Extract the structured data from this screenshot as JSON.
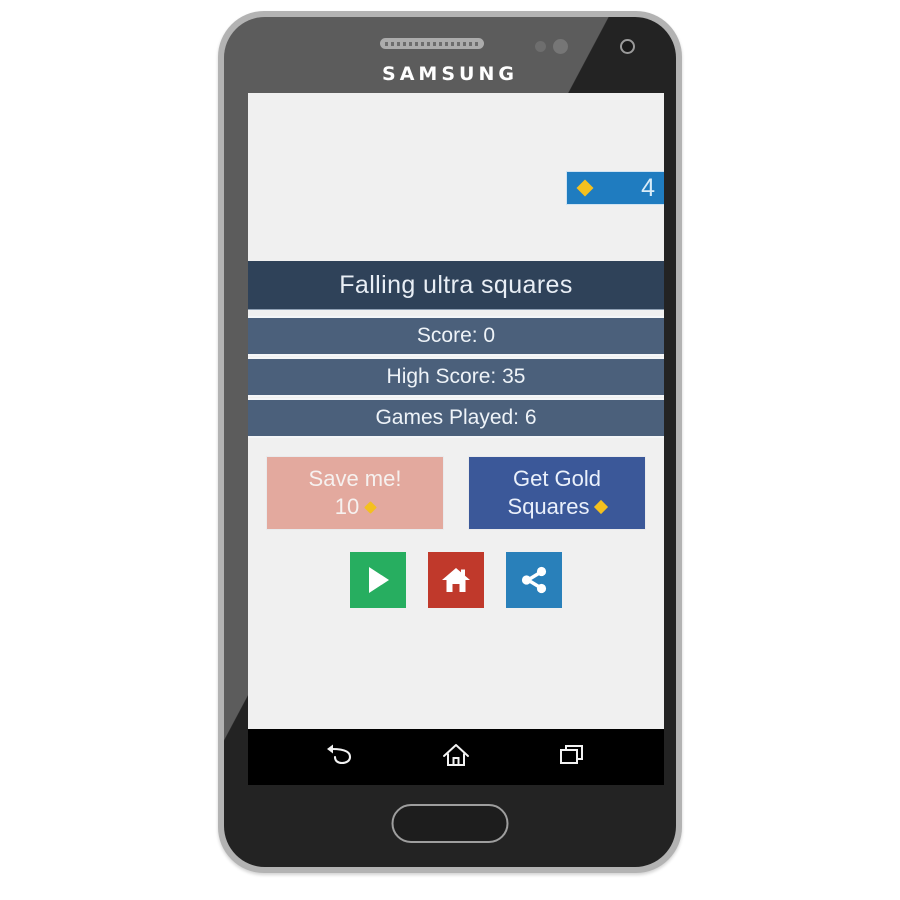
{
  "device": {
    "brand_label": "SAMSUNG",
    "frame_color": "#b3b3b3",
    "body_color": "#232323"
  },
  "app": {
    "title": "Falling ultra squares",
    "title_bar_color": "#2f4259",
    "screen_background": "#f0f0f0"
  },
  "gold_badge": {
    "count": "4",
    "icon": "gold-diamond-icon",
    "background": "#1f7cc0",
    "diamond_color": "#f4c01e"
  },
  "stats": [
    {
      "label": "Score: 0"
    },
    {
      "label": "High Score: 35"
    },
    {
      "label": "Games Played: 6"
    }
  ],
  "stats_style": {
    "row_color": "#4b607b",
    "text_color": "#eef3f8"
  },
  "actions": {
    "save_me": {
      "label": "Save me!",
      "cost": "10",
      "currency_icon": "gold-diamond-icon",
      "background": "#e3a99e"
    },
    "get_gold": {
      "line1": "Get Gold",
      "line2": "Squares",
      "currency_icon": "gold-diamond-icon",
      "background": "#3b5899"
    }
  },
  "icon_buttons": [
    {
      "name": "play-button",
      "icon": "play-icon",
      "color": "#27ae60"
    },
    {
      "name": "home-button",
      "icon": "home-icon",
      "color": "#c0392b"
    },
    {
      "name": "share-button",
      "icon": "share-icon",
      "color": "#2980ba"
    }
  ],
  "nav_bar": {
    "background": "#000000",
    "buttons": [
      {
        "name": "back-button",
        "icon": "back-arrow-icon"
      },
      {
        "name": "home-button",
        "icon": "home-outline-icon"
      },
      {
        "name": "recents-button",
        "icon": "recents-icon"
      }
    ]
  }
}
